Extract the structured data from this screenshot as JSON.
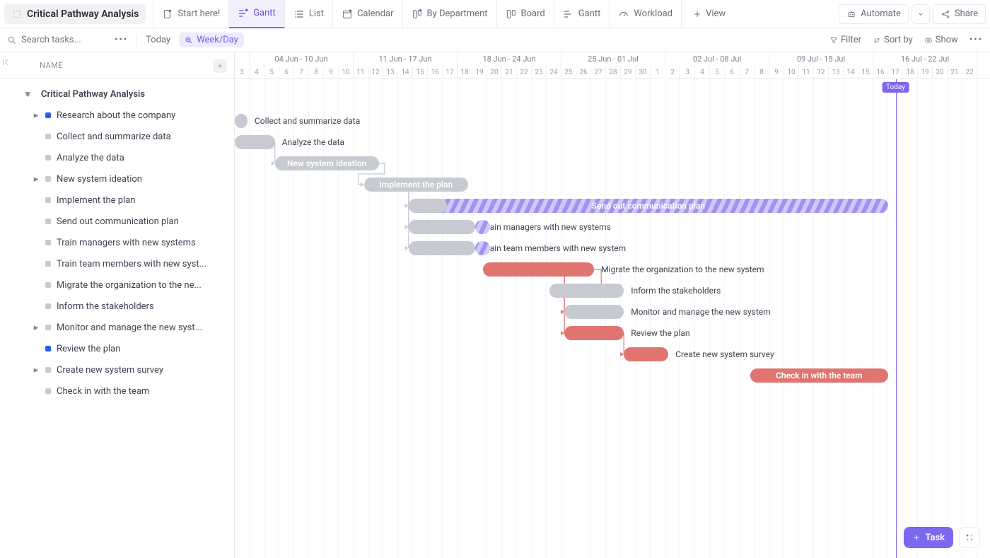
{
  "space": {
    "title": "Critical Pathway Analysis"
  },
  "views": {
    "start": "Start here!",
    "gantt": "Gantt",
    "list": "List",
    "calendar": "Calendar",
    "bydept": "By Department",
    "board": "Board",
    "gantt2": "Gantt",
    "workload": "Workload",
    "add": "View"
  },
  "topRight": {
    "automate": "Automate",
    "share": "Share"
  },
  "filter": {
    "search_placeholder": "Search tasks...",
    "today": "Today",
    "weekday": "Week/Day",
    "filter": "Filter",
    "sortby": "Sort by",
    "show": "Show"
  },
  "sidebar": {
    "header": "NAME",
    "root": "Critical Pathway Analysis",
    "items": [
      {
        "label": "Research about the company",
        "color": "blue",
        "caret": true
      },
      {
        "label": "Collect and summarize data",
        "color": "grey"
      },
      {
        "label": "Analyze the data",
        "color": "grey"
      },
      {
        "label": "New system ideation",
        "color": "grey",
        "caret": true
      },
      {
        "label": "Implement the plan",
        "color": "grey"
      },
      {
        "label": "Send out communication plan",
        "color": "grey"
      },
      {
        "label": "Train managers with new systems",
        "color": "grey"
      },
      {
        "label": "Train team members with new syst...",
        "color": "grey"
      },
      {
        "label": "Migrate the organization to the ne...",
        "color": "grey"
      },
      {
        "label": "Inform the stakeholders",
        "color": "grey"
      },
      {
        "label": "Monitor and manage the new syst...",
        "color": "grey",
        "caret": true
      },
      {
        "label": "Review the plan",
        "color": "blue"
      },
      {
        "label": "Create new system survey",
        "color": "grey",
        "caret": true
      },
      {
        "label": "Check in with the team",
        "color": "grey"
      }
    ]
  },
  "timeline": {
    "dayWidth": 21,
    "startDay": 3,
    "weeks": [
      {
        "label": "04 Jun - 10 Jun",
        "span": 7
      },
      {
        "label": "11 Jun - 17 Jun",
        "span": 7
      },
      {
        "label": "18 Jun - 24 Jun",
        "span": 7
      },
      {
        "label": "25 Jun - 01 Jul",
        "span": 7
      },
      {
        "label": "02 Jul - 08 Jul",
        "span": 7
      },
      {
        "label": "09 Jul - 15 Jul",
        "span": 7
      },
      {
        "label": "16 Jul - 22 Jul",
        "span": 7
      }
    ],
    "days": [
      3,
      4,
      5,
      6,
      7,
      8,
      9,
      10,
      11,
      12,
      13,
      14,
      15,
      16,
      17,
      18,
      19,
      20,
      21,
      22,
      23,
      24,
      25,
      26,
      27,
      28,
      29,
      30,
      1,
      2,
      3,
      4,
      5,
      6,
      7,
      8,
      9,
      10,
      11,
      12,
      13,
      14,
      15,
      16,
      17,
      18,
      19,
      20,
      21,
      22
    ],
    "todayIndex": 44,
    "todayLabel": "Today"
  },
  "bars": [
    {
      "row": 1,
      "start": 0,
      "end": 0.4,
      "kind": "grey",
      "label": "Collect and summarize data",
      "labelPos": "out"
    },
    {
      "row": 2,
      "start": 0,
      "end": 2.7,
      "kind": "grey",
      "label": "Analyze the data",
      "labelPos": "out"
    },
    {
      "row": 3,
      "start": 2.7,
      "end": 9.7,
      "kind": "grey",
      "label": "New system ideation",
      "labelPos": "in"
    },
    {
      "row": 4,
      "start": 8.7,
      "end": 15.7,
      "kind": "grey",
      "label": "Implement the plan",
      "labelPos": "in"
    },
    {
      "row": 5,
      "start": 11.7,
      "end": 44,
      "kind": "hatch",
      "label": "Send out communication plan",
      "labelPos": "in"
    },
    {
      "row": 5,
      "start": 11.7,
      "end": 14.3,
      "kind": "grey",
      "label": "",
      "labelPos": "none"
    },
    {
      "row": 6,
      "start": 11.7,
      "end": 16.2,
      "kind": "grey",
      "label": "Train managers with new systems",
      "labelPos": "out"
    },
    {
      "row": 6,
      "start": 16.2,
      "end": 17.2,
      "kind": "hatch",
      "label": "",
      "labelPos": "none"
    },
    {
      "row": 7,
      "start": 11.7,
      "end": 16.2,
      "kind": "grey",
      "label": "Train team members with new system",
      "labelPos": "out"
    },
    {
      "row": 7,
      "start": 16.2,
      "end": 17.2,
      "kind": "hatch",
      "label": "",
      "labelPos": "none"
    },
    {
      "row": 8,
      "start": 16.7,
      "end": 24.2,
      "kind": "red",
      "label": "Migrate the organization to the new system",
      "labelPos": "out"
    },
    {
      "row": 9,
      "start": 21.2,
      "end": 26.2,
      "kind": "grey",
      "label": "Inform the stakeholders",
      "labelPos": "out"
    },
    {
      "row": 10,
      "start": 22.2,
      "end": 26.2,
      "kind": "grey",
      "label": "Monitor and manage the new system",
      "labelPos": "out"
    },
    {
      "row": 11,
      "start": 22.2,
      "end": 26.2,
      "kind": "red",
      "label": "Review the plan",
      "labelPos": "out"
    },
    {
      "row": 12,
      "start": 26.2,
      "end": 29.2,
      "kind": "red",
      "label": "Create new system survey",
      "labelPos": "out"
    },
    {
      "row": 13,
      "start": 34.7,
      "end": 44,
      "kind": "red",
      "label": "Check in with the team",
      "labelPos": "in"
    }
  ],
  "deps": [
    {
      "from": {
        "row": 2,
        "x": 2.7
      },
      "to": {
        "row": 3,
        "x": 2.7
      },
      "color": "#c7cad1"
    },
    {
      "from": {
        "row": 3,
        "x": 9.7
      },
      "to": {
        "row": 4,
        "x": 8.7
      },
      "color": "#c7cad1",
      "back": true
    },
    {
      "from": {
        "row": 4,
        "x": 11.7
      },
      "to": {
        "row": 5,
        "x": 11.7
      },
      "color": "#c7cad1"
    },
    {
      "from": {
        "row": 4,
        "x": 11.7
      },
      "to": {
        "row": 6,
        "x": 11.7
      },
      "color": "#c7cad1"
    },
    {
      "from": {
        "row": 4,
        "x": 11.7
      },
      "to": {
        "row": 7,
        "x": 11.7
      },
      "color": "#c7cad1"
    },
    {
      "from": {
        "row": 8,
        "x": 24.2
      },
      "to": {
        "row": 9,
        "x": 26.2
      },
      "color": "#e07470",
      "forward": true
    },
    {
      "from": {
        "row": 8,
        "x": 22.2
      },
      "to": {
        "row": 10,
        "x": 22.2
      },
      "color": "#e07470"
    },
    {
      "from": {
        "row": 8,
        "x": 22.2
      },
      "to": {
        "row": 11,
        "x": 22.2
      },
      "color": "#e07470"
    },
    {
      "from": {
        "row": 11,
        "x": 26.2
      },
      "to": {
        "row": 12,
        "x": 26.2
      },
      "color": "#e07470"
    }
  ],
  "fab": {
    "task": "Task"
  }
}
